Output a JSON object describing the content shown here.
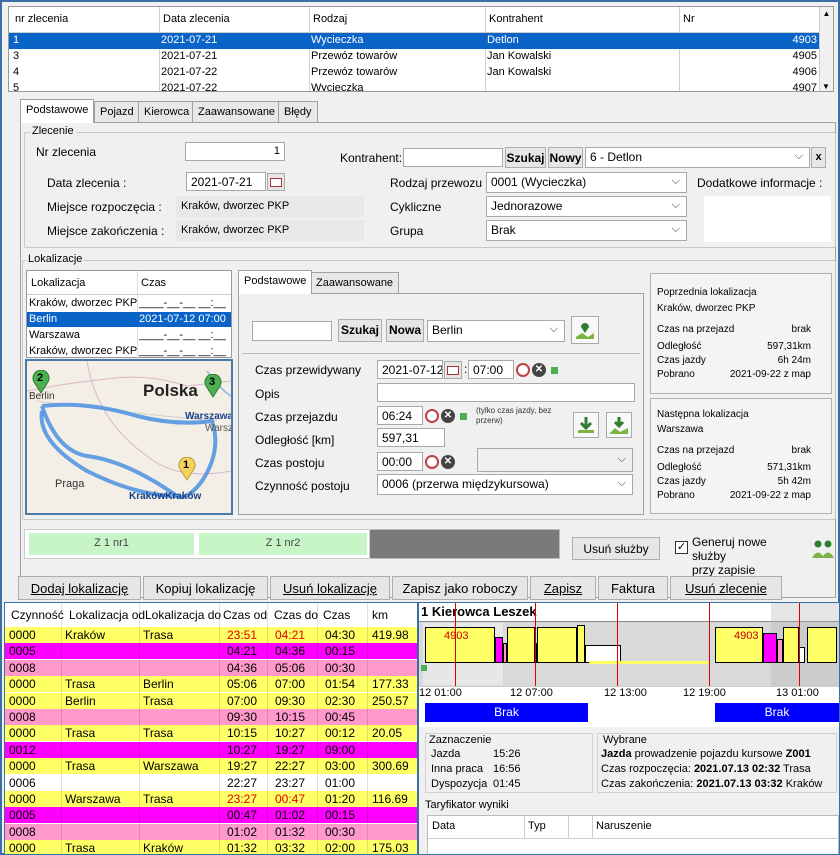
{
  "orders": {
    "headers": [
      "nr zlecenia",
      "Data zlecenia",
      "Rodzaj",
      "Kontrahent",
      "Nr"
    ],
    "rows": [
      {
        "nr": "1",
        "date": "2021-07-21",
        "type": "Wycieczka",
        "client": "Detlon",
        "num": "4903"
      },
      {
        "nr": "3",
        "date": "2021-07-21",
        "type": "Przewóz towarów",
        "client": "Jan Kowalski",
        "num": "4905"
      },
      {
        "nr": "4",
        "date": "2021-07-22",
        "type": "Przewóz towarów",
        "client": "Jan Kowalski",
        "num": "4906"
      },
      {
        "nr": "5",
        "date": "2021-07-22",
        "type": "Wycieczka",
        "client": "",
        "num": "4907"
      }
    ]
  },
  "tabs": [
    "Podstawowe",
    "Pojazd",
    "Kierowca",
    "Zaawansowane",
    "Błędy"
  ],
  "zlecenie": {
    "group_title": "Zlecenie",
    "nr_label": "Nr zlecenia",
    "nr_value": "1",
    "kontrahent_label": "Kontrahent:",
    "kontrahent_value": "",
    "szukaj": "Szukaj",
    "nowy": "Nowy",
    "kontrahent_combo": "6 - Detlon",
    "x": "x",
    "data_label": "Data zlecenia  :",
    "data_value": "2021-07-21",
    "rodzaj_label": "Rodzaj przewozu",
    "rodzaj_value": "0001  (Wycieczka)",
    "dodatkowe_label": "Dodatkowe informacje :",
    "miejsce_start_label": "Miejsce rozpoczęcia :",
    "miejsce_start_value": "Kraków, dworzec PKP",
    "cykliczne_label": "Cykliczne",
    "cykliczne_value": "Jednorazowe",
    "miejsce_end_label": "Miejsce zakończenia :",
    "miejsce_end_value": "Kraków, dworzec PKP",
    "grupa_label": "Grupa",
    "grupa_value": "Brak"
  },
  "lokalizacje": {
    "group_title": "Lokalizacje",
    "headers": [
      "Lokalizacja",
      "Czas"
    ],
    "rows": [
      {
        "loc": "Kraków, dworzec PKP",
        "time": "____-__-__ __:__"
      },
      {
        "loc": "Berlin",
        "time": "2021-07-12 07:00"
      },
      {
        "loc": "Warszawa",
        "time": "____-__-__ __:__"
      },
      {
        "loc": "Kraków, dworzec PKP",
        "time": "____-__-__ __:__"
      }
    ],
    "map": {
      "country": "Polska",
      "berlin": "Berlin",
      "warszawa": "Warszawa",
      "warszawa2": "Warsza",
      "praga": "Praga",
      "krakow": "KrakówKraków",
      "pins": [
        "2",
        "3",
        "1"
      ]
    }
  },
  "loc_tabs": [
    "Podstawowe",
    "Zaawansowane"
  ],
  "locform": {
    "szukaj": "Szukaj",
    "nowa": "Nowa",
    "combo": "Berlin",
    "czas_przew_label": "Czas przewidywany",
    "czas_przew_date": "2021-07-12",
    "czas_przew_time": "07:00",
    "opis_label": "Opis",
    "czas_przejazdu_label": "Czas przejazdu",
    "czas_przejazdu_value": "06:24",
    "note": "(tylko czas jazdy, bez przerw)",
    "odleglosc_label": "Odległość [km]",
    "odleglosc_value": "597,31",
    "czas_postoju_label": "Czas postoju",
    "czas_postoju_value": "00:00",
    "czynnosc_label": "Czynność postoju",
    "czynnosc_value": "0006  (przerwa międzykursowa)"
  },
  "prev": {
    "title": "Poprzednia lokalizacja",
    "name": "Kraków, dworzec PKP",
    "rows": [
      [
        "Czas na przejazd",
        "brak"
      ],
      [
        "Odległość",
        "597,31km"
      ],
      [
        "Czas jazdy",
        "6h 24m"
      ],
      [
        "Pobrano",
        "2021-09-22 z map"
      ]
    ]
  },
  "next": {
    "title": "Następna lokalizacja",
    "name": "Warszawa",
    "rows": [
      [
        "Czas na przejazd",
        "brak"
      ],
      [
        "Odległość",
        "571,31km"
      ],
      [
        "Czas jazdy",
        "5h 42m"
      ],
      [
        "Pobrano",
        "2021-09-22 z map"
      ]
    ]
  },
  "services": {
    "s1": "Z 1 nr1",
    "s2": "Z 1 nr2",
    "usun": "Usuń służby",
    "gen": "Generuj nowe służby przy zapisie",
    "gen1": "Generuj nowe służby",
    "gen2": "przy zapisie"
  },
  "actions": [
    "Dodaj lokalizację",
    "Kopiuj lokalizację",
    "Usuń lokalizację",
    "Zapisz jako roboczy",
    "Zapisz",
    "Faktura",
    "Usuń zlecenie"
  ],
  "activities": {
    "headers": [
      "Czynność",
      "Lokalizacja od",
      "Lokalizacja do",
      "Czas od",
      "Czas do",
      "Czas",
      "km"
    ],
    "rows": [
      {
        "c": "0000",
        "from": "Kraków",
        "to": "Trasa",
        "t1": "23:51",
        "t2": "04:21",
        "d": "04:30",
        "km": "419.98",
        "color": "yellow",
        "red": true
      },
      {
        "c": "0005",
        "from": "",
        "to": "",
        "t1": "04:21",
        "t2": "04:36",
        "d": "00:15",
        "km": "",
        "color": "magenta",
        "red": false
      },
      {
        "c": "0008",
        "from": "",
        "to": "",
        "t1": "04:36",
        "t2": "05:06",
        "d": "00:30",
        "km": "",
        "color": "pink",
        "red": false
      },
      {
        "c": "0000",
        "from": "Trasa",
        "to": "Berlin",
        "t1": "05:06",
        "t2": "07:00",
        "d": "01:54",
        "km": "177.33",
        "color": "yellow",
        "red": false
      },
      {
        "c": "0000",
        "from": "Berlin",
        "to": "Trasa",
        "t1": "07:00",
        "t2": "09:30",
        "d": "02:30",
        "km": "250.57",
        "color": "yellow",
        "red": false
      },
      {
        "c": "0008",
        "from": "",
        "to": "",
        "t1": "09:30",
        "t2": "10:15",
        "d": "00:45",
        "km": "",
        "color": "pink",
        "red": false
      },
      {
        "c": "0000",
        "from": "Trasa",
        "to": "Trasa",
        "t1": "10:15",
        "t2": "10:27",
        "d": "00:12",
        "km": "20.05",
        "color": "yellow",
        "red": false
      },
      {
        "c": "0012",
        "from": "",
        "to": "",
        "t1": "10:27",
        "t2": "19:27",
        "d": "09:00",
        "km": "",
        "color": "magenta",
        "red": false
      },
      {
        "c": "0000",
        "from": "Trasa",
        "to": "Warszawa",
        "t1": "19:27",
        "t2": "22:27",
        "d": "03:00",
        "km": "300.69",
        "color": "yellow",
        "red": false
      },
      {
        "c": "0006",
        "from": "",
        "to": "",
        "t1": "22:27",
        "t2": "23:27",
        "d": "01:00",
        "km": "",
        "color": "white",
        "red": false
      },
      {
        "c": "0000",
        "from": "Warszawa",
        "to": "Trasa",
        "t1": "23:27",
        "t2": "00:47",
        "d": "01:20",
        "km": "116.69",
        "color": "yellow",
        "red": true
      },
      {
        "c": "0005",
        "from": "",
        "to": "",
        "t1": "00:47",
        "t2": "01:02",
        "d": "00:15",
        "km": "",
        "color": "magenta",
        "red": false
      },
      {
        "c": "0008",
        "from": "",
        "to": "",
        "t1": "01:02",
        "t2": "01:32",
        "d": "00:30",
        "km": "",
        "color": "pink",
        "red": false
      },
      {
        "c": "0000",
        "from": "Trasa",
        "to": "Kraków",
        "t1": "01:32",
        "t2": "03:32",
        "d": "02:00",
        "km": "175.03",
        "color": "yellow",
        "red": false
      }
    ]
  },
  "timeline": {
    "driver": "1 Kierowca Leszek",
    "block_label": "4903",
    "ticks": [
      "12 01:00",
      "12 07:00",
      "12 13:00",
      "12 19:00",
      "13 01:00"
    ],
    "brak": "Brak",
    "zaznaczenie": {
      "title": "Zaznaczenie",
      "rows": [
        [
          "Jazda",
          "15:26"
        ],
        [
          "Inna praca",
          "16:56"
        ],
        [
          "Dyspozycja",
          "01:45"
        ]
      ]
    },
    "wybrane": {
      "title": "Wybrane",
      "l1a": "Jazda",
      "l1b": " prowadzenie pojazdu kursowe ",
      "l1c": "Z001",
      "l2a": "Czas rozpoczęcia: ",
      "l2b": "2021.07.13 02:32",
      "l2c": " Trasa",
      "l3a": "Czas zakończenia: ",
      "l3b": "2021.07.13 03:32",
      "l3c": " Kraków"
    },
    "taryf": {
      "title": "Taryfikator wyniki",
      "headers": [
        "Data",
        "Typ",
        "Naruszenie"
      ]
    }
  }
}
